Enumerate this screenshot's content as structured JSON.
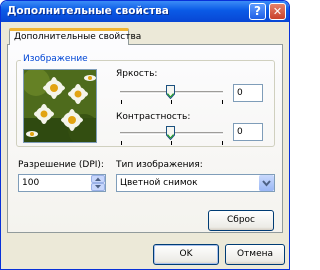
{
  "window": {
    "title": "Дополнительные свойства",
    "help_glyph": "?",
    "close_glyph": "✕"
  },
  "tab": {
    "label": "Дополнительные свойства"
  },
  "group": {
    "label": "Изображение"
  },
  "brightness": {
    "label": "Яркость:",
    "value": "0",
    "level": 0.5
  },
  "contrast": {
    "label": "Контрастность:",
    "value": "0",
    "level": 0.5
  },
  "resolution": {
    "label": "Разрешение (DPI):",
    "value": "100"
  },
  "image_type": {
    "label": "Тип изображения:",
    "selected": "Цветной снимок"
  },
  "buttons": {
    "reset": "Сброс",
    "ok": "OK",
    "cancel": "Отмена"
  }
}
